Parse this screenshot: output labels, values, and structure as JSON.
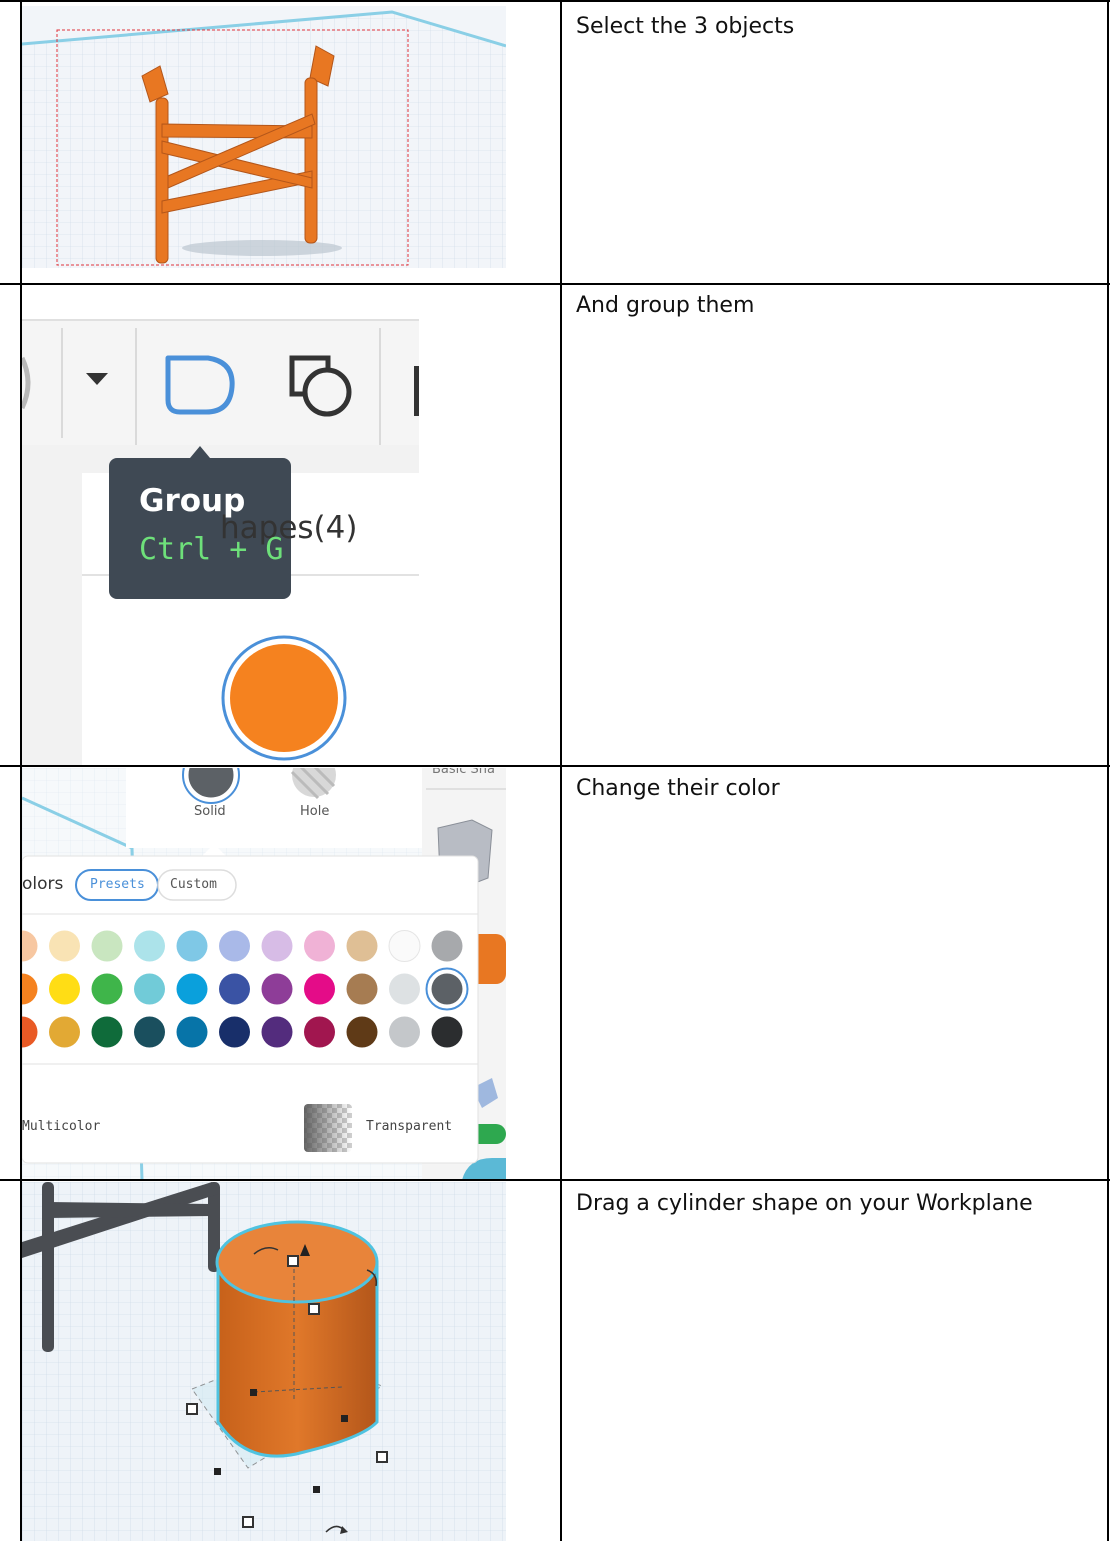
{
  "steps": [
    {
      "instruction": "Select the 3 objects"
    },
    {
      "instruction": "And group them"
    },
    {
      "instruction": "Change their color"
    },
    {
      "instruction": "Drag a cylinder shape on your Workplane"
    }
  ],
  "group_panel": {
    "tooltip_title": "Group",
    "tooltip_shortcut": "Ctrl + G",
    "shapes_label": "hapes(4)",
    "icons": [
      "dropdown-arrow-icon",
      "group-icon",
      "ungroup-icon"
    ],
    "current_color": "#F5821F"
  },
  "color_panel": {
    "solid_label": "Solid",
    "hole_label": "Hole",
    "colors_label": "olors",
    "presets_label": "Presets",
    "custom_label": "Custom",
    "multicolor_label": "Multicolor",
    "transparent_label": "Transparent",
    "partial_header": "Basic Sha",
    "swatch_rows": [
      [
        "#F7C7A1",
        "#F9E3B4",
        "#C9E6C0",
        "#ACE3EA",
        "#7FC8E6",
        "#A9B9E8",
        "#D7BCE6",
        "#F0B2D6",
        "#DFBF95",
        "#FAFAFA",
        "#A7A9AC"
      ],
      [
        "#F5821F",
        "#FFDD15",
        "#3FB54A",
        "#71CBD8",
        "#0AA0DC",
        "#3A53A4",
        "#8E3D98",
        "#E40C88",
        "#A67C52",
        "#DDE1E3",
        "#5C6166"
      ],
      [
        "#E95A25",
        "#E2A934",
        "#0F6B3A",
        "#1A4F5E",
        "#0774A8",
        "#182F6A",
        "#532C7D",
        "#A1164F",
        "#5F3A17",
        "#C4C7CA",
        "#2B2D2F"
      ]
    ],
    "selected_swatch_color": "#5C6166"
  },
  "colors": {
    "orange": "#F5821F",
    "workplane_blue": "#7FC6DF",
    "grid_bg": "#EEF3F8",
    "dark_gray": "#4A4D52",
    "select_blue": "#4A90D9"
  }
}
